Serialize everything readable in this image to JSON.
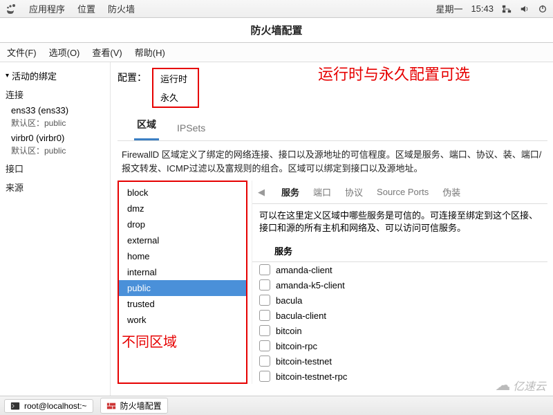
{
  "topbar": {
    "apps": "应用程序",
    "places": "位置",
    "firewall": "防火墙",
    "day": "星期一",
    "time": "15:43"
  },
  "window": {
    "title": "防火墙配置"
  },
  "menu": {
    "file": "文件(F)",
    "options": "选项(O)",
    "view": "查看(V)",
    "help": "帮助(H)"
  },
  "sidebar": {
    "header": "活动的绑定",
    "conn_title": "连接",
    "items": [
      {
        "name": "ens33 (ens33)",
        "default": "默认区：public"
      },
      {
        "name": "virbr0 (virbr0)",
        "default": "默认区：public"
      }
    ],
    "interfaces": "接口",
    "sources": "来源"
  },
  "config": {
    "label": "配置：",
    "opt_runtime": "运行时",
    "opt_permanent": "永久"
  },
  "annotations": {
    "top": "运行时与永久配置可选",
    "bottom": "不同区域"
  },
  "tabs": {
    "zones": "区域",
    "ipsets": "IPSets"
  },
  "zone_desc": "FirewallD 区域定义了绑定的网络连接、接口以及源地址的可信程度。区域是服务、端口、协议、装、端口/报文转发、ICMP过滤以及富规则的组合。区域可以绑定到接口以及源地址。",
  "zones": [
    "block",
    "dmz",
    "drop",
    "external",
    "home",
    "internal",
    "public",
    "trusted",
    "work"
  ],
  "zone_selected": "public",
  "sub_tabs": {
    "services": "服务",
    "ports": "端口",
    "protocols": "协议",
    "source_ports": "Source Ports",
    "spoof": "伪装"
  },
  "svc_desc": "可以在这里定义区域中哪些服务是可信的。可连接至绑定到这个区接、接口和源的所有主机和网络及、可以访问可信服务。",
  "svc_header": "服务",
  "services": [
    "amanda-client",
    "amanda-k5-client",
    "bacula",
    "bacula-client",
    "bitcoin",
    "bitcoin-rpc",
    "bitcoin-testnet",
    "bitcoin-testnet-rpc"
  ],
  "taskbar": {
    "terminal": "root@localhost:~",
    "firewall": "防火墙配置"
  },
  "watermark": "亿速云"
}
